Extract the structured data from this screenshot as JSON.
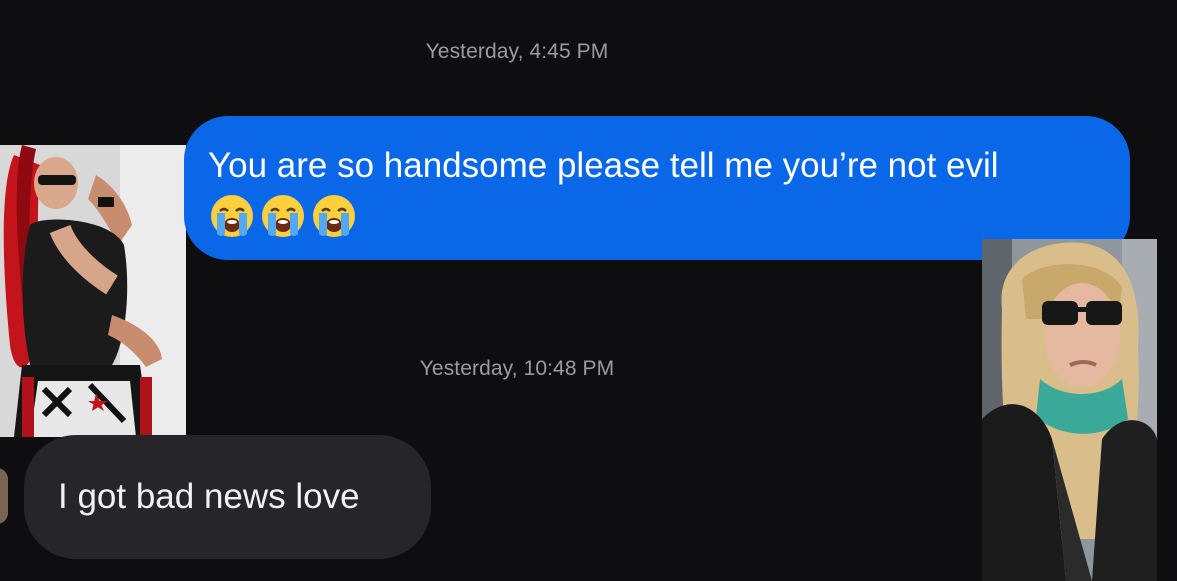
{
  "conversation": {
    "messages": [
      {
        "timestamp": "Yesterday, 4:45 PM",
        "direction": "sent",
        "text": "You are so handsome please tell me you’re not evil",
        "emojis": [
          "loudly-crying-face",
          "loudly-crying-face",
          "loudly-crying-face"
        ]
      },
      {
        "timestamp": "Yesterday, 10:48 PM",
        "direction": "received",
        "text": "I got bad news love"
      }
    ]
  },
  "colors": {
    "background": "#0e0e10",
    "sent_bubble": "#0a67e8",
    "received_bubble": "#26262a",
    "timestamp_text": "#9b9ba1"
  }
}
